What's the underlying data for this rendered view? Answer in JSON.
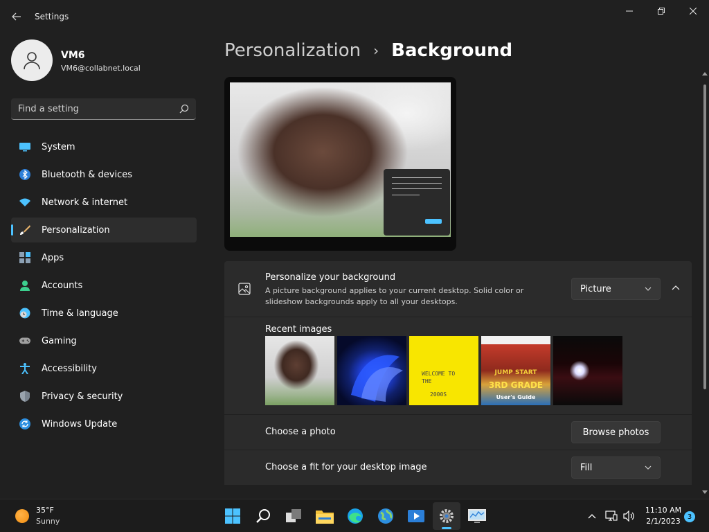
{
  "window": {
    "title": "Settings",
    "controls": {
      "minimize_icon": "minimize-icon",
      "maximize_icon": "maximize-icon",
      "close_icon": "close-icon"
    }
  },
  "profile": {
    "name": "VM6",
    "email": "VM6@collabnet.local"
  },
  "search": {
    "placeholder": "Find a setting"
  },
  "sidebar": {
    "items": [
      {
        "label": "System",
        "icon": "monitor-icon"
      },
      {
        "label": "Bluetooth & devices",
        "icon": "bluetooth-icon"
      },
      {
        "label": "Network & internet",
        "icon": "wifi-icon"
      },
      {
        "label": "Personalization",
        "icon": "brush-icon",
        "active": true
      },
      {
        "label": "Apps",
        "icon": "apps-icon"
      },
      {
        "label": "Accounts",
        "icon": "person-icon"
      },
      {
        "label": "Time & language",
        "icon": "globe-clock-icon"
      },
      {
        "label": "Gaming",
        "icon": "gamepad-icon"
      },
      {
        "label": "Accessibility",
        "icon": "accessibility-icon"
      },
      {
        "label": "Privacy & security",
        "icon": "shield-icon"
      },
      {
        "label": "Windows Update",
        "icon": "update-icon"
      }
    ]
  },
  "breadcrumb": {
    "parent": "Personalization",
    "separator": "›",
    "current": "Background"
  },
  "personalize": {
    "title": "Personalize your background",
    "description": "A picture background applies to your current desktop. Solid color or slideshow backgrounds apply to all your desktops.",
    "dropdown_value": "Picture"
  },
  "recent": {
    "label": "Recent images",
    "thumb3_text": [
      "WELCOME TO",
      "THE",
      "2000S"
    ],
    "thumb4_text": [
      "JUMP START",
      "3RD GRADE",
      "User's Guide"
    ]
  },
  "photo": {
    "label": "Choose a photo",
    "button": "Browse photos"
  },
  "fit": {
    "label": "Choose a fit for your desktop image",
    "dropdown_value": "Fill"
  },
  "taskbar": {
    "weather": {
      "temp": "35°F",
      "condition": "Sunny"
    },
    "clock": {
      "time": "11:10 AM",
      "date": "2/1/2023"
    },
    "notifications": "3"
  },
  "colors": {
    "accent": "#4cc2ff",
    "background": "#202020",
    "card": "#2b2b2b"
  }
}
